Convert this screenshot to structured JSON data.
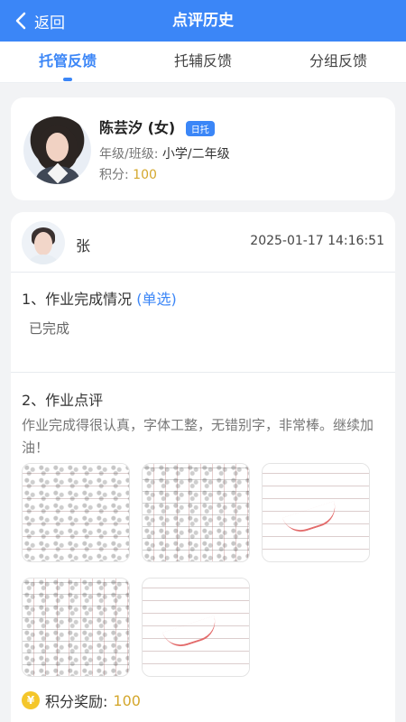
{
  "header": {
    "back_label": "返回",
    "title": "点评历史"
  },
  "tabs": [
    {
      "label": "托管反馈"
    },
    {
      "label": "托辅反馈"
    },
    {
      "label": "分组反馈"
    }
  ],
  "student": {
    "name": "陈芸汐 (女)",
    "badge": "日托",
    "grade_label": "年级/班级:",
    "grade_value": "小学/二年级",
    "score_label": "积分:",
    "score_value": "100"
  },
  "review": {
    "teacher_name": "张",
    "time": "2025-01-17 14:16:51",
    "q1": {
      "title": "1、作业完成情况",
      "select": "(单选)",
      "answer": "已完成"
    },
    "q2": {
      "title": "2、作业点评",
      "comment": "作业完成得很认真，字体工整，无错别字，非常棒。继续加油！"
    },
    "photos": [
      "homework-photo-1",
      "homework-photo-2",
      "homework-photo-3",
      "homework-photo-4",
      "homework-photo-5"
    ],
    "reward_label": "积分奖励:",
    "reward_value": "100"
  },
  "colors": {
    "primary": "#3b86f7",
    "score": "#d4a72c"
  }
}
